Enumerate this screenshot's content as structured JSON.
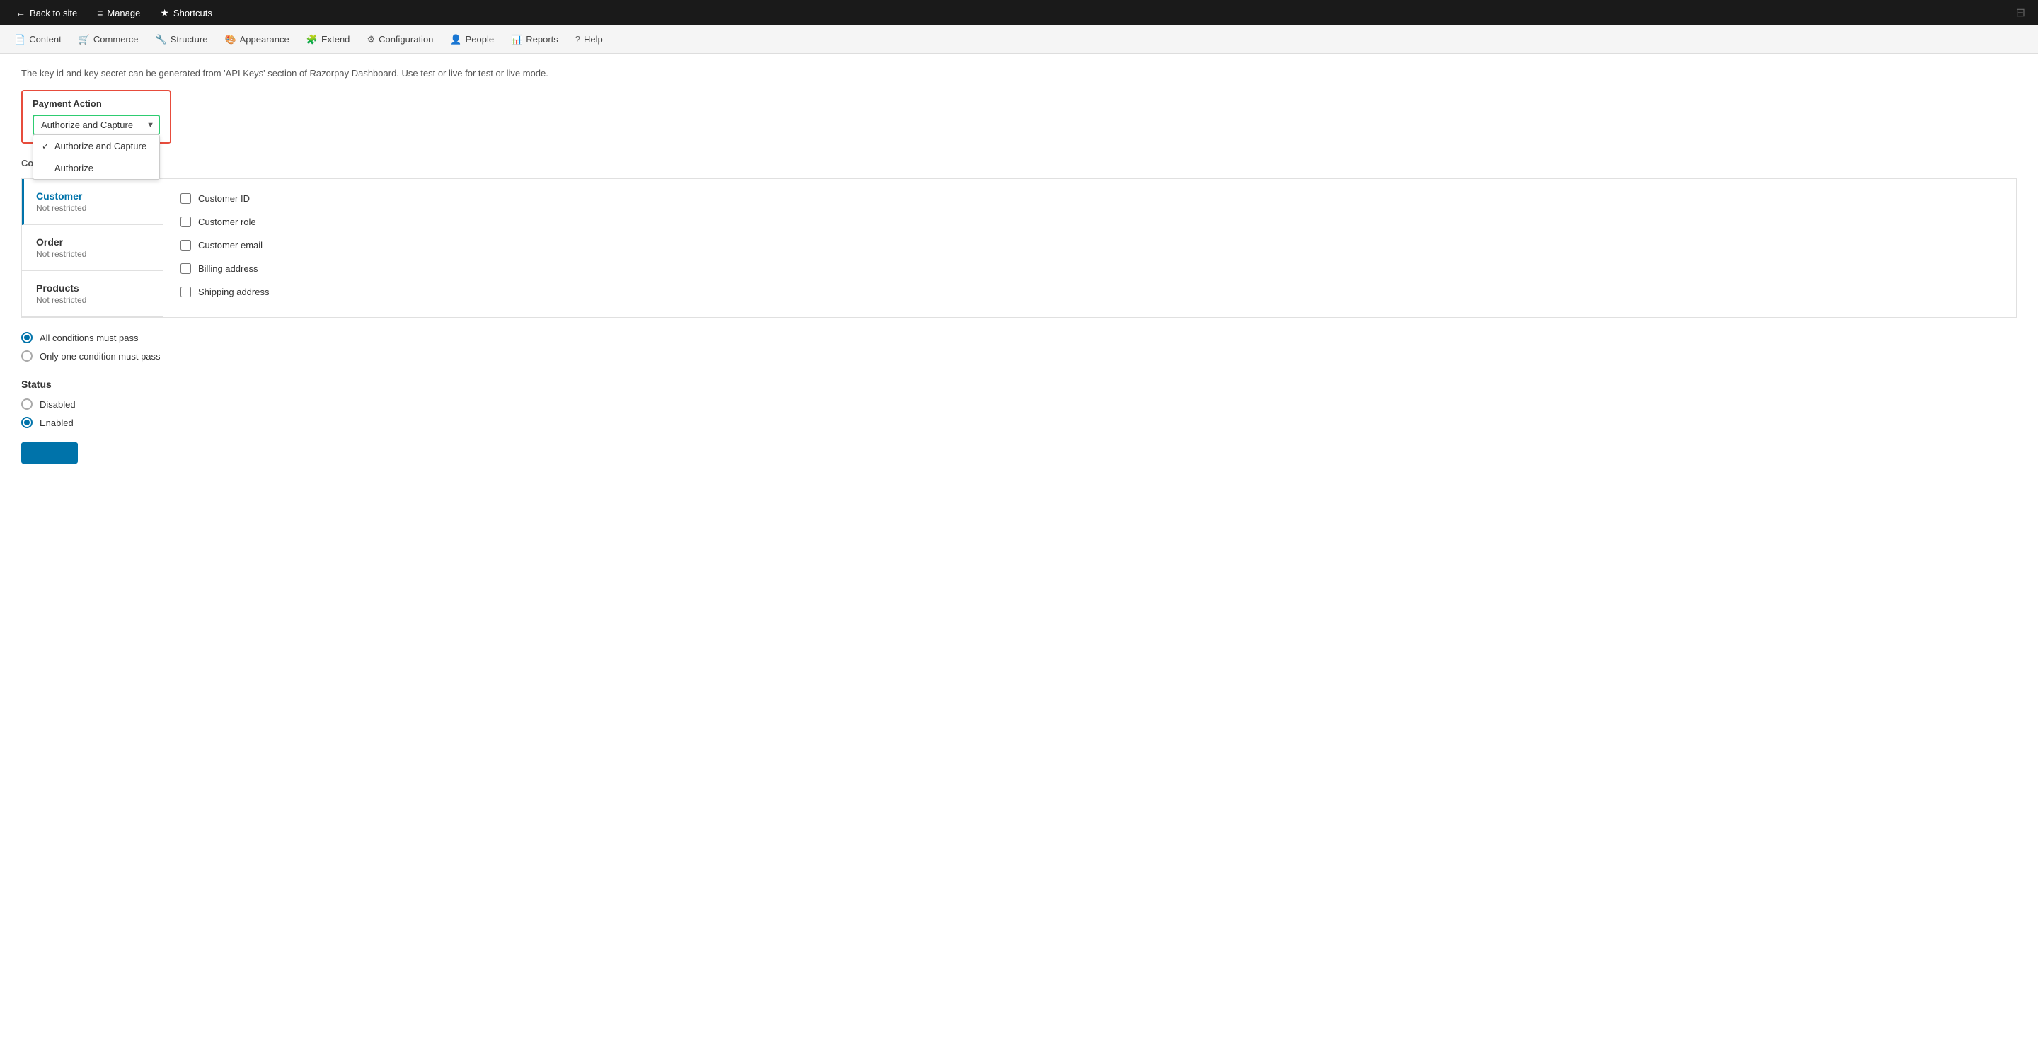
{
  "admin_toolbar": {
    "items": [
      {
        "id": "back-to-site",
        "label": "Back to site",
        "icon": "←",
        "active": false
      },
      {
        "id": "manage",
        "label": "Manage",
        "icon": "≡",
        "active": false
      },
      {
        "id": "shortcuts",
        "label": "Shortcuts",
        "icon": "★",
        "active": false
      }
    ]
  },
  "main_nav": {
    "items": [
      {
        "id": "content",
        "label": "Content",
        "icon": "📄"
      },
      {
        "id": "commerce",
        "label": "Commerce",
        "icon": "🛒"
      },
      {
        "id": "structure",
        "label": "Structure",
        "icon": "🔧"
      },
      {
        "id": "appearance",
        "label": "Appearance",
        "icon": "🎨"
      },
      {
        "id": "extend",
        "label": "Extend",
        "icon": "🧩"
      },
      {
        "id": "configuration",
        "label": "Configuration",
        "icon": "⚙"
      },
      {
        "id": "people",
        "label": "People",
        "icon": "👤"
      },
      {
        "id": "reports",
        "label": "Reports",
        "icon": "📊"
      },
      {
        "id": "help",
        "label": "Help",
        "icon": "?"
      }
    ]
  },
  "page": {
    "info_text": "The key id and key secret can be generated from 'API Keys' section of Razorpay Dashboard. Use test or live for test or live mode.",
    "payment_action": {
      "label": "Payment Action",
      "selected": "Authorize and Capture",
      "options": [
        {
          "label": "Authorize and Capture",
          "selected": true
        },
        {
          "label": "Authorize",
          "selected": false
        }
      ]
    },
    "conditions": {
      "label": "Conditions",
      "tabs": [
        {
          "id": "customer",
          "title": "Customer",
          "subtitle": "Not restricted",
          "active": true
        },
        {
          "id": "order",
          "title": "Order",
          "subtitle": "Not restricted",
          "active": false
        },
        {
          "id": "products",
          "title": "Products",
          "subtitle": "Not restricted",
          "active": false
        }
      ],
      "customer_options": [
        {
          "id": "customer-id",
          "label": "Customer ID",
          "checked": false
        },
        {
          "id": "customer-role",
          "label": "Customer role",
          "checked": false
        },
        {
          "id": "customer-email",
          "label": "Customer email",
          "checked": false
        },
        {
          "id": "billing-address",
          "label": "Billing address",
          "checked": false
        },
        {
          "id": "shipping-address",
          "label": "Shipping address",
          "checked": false
        }
      ]
    },
    "condition_logic": {
      "options": [
        {
          "id": "all-pass",
          "label": "All conditions must pass",
          "selected": true
        },
        {
          "id": "one-pass",
          "label": "Only one condition must pass",
          "selected": false
        }
      ]
    },
    "status": {
      "title": "Status",
      "options": [
        {
          "id": "disabled",
          "label": "Disabled",
          "selected": false
        },
        {
          "id": "enabled",
          "label": "Enabled",
          "selected": true
        }
      ]
    }
  }
}
